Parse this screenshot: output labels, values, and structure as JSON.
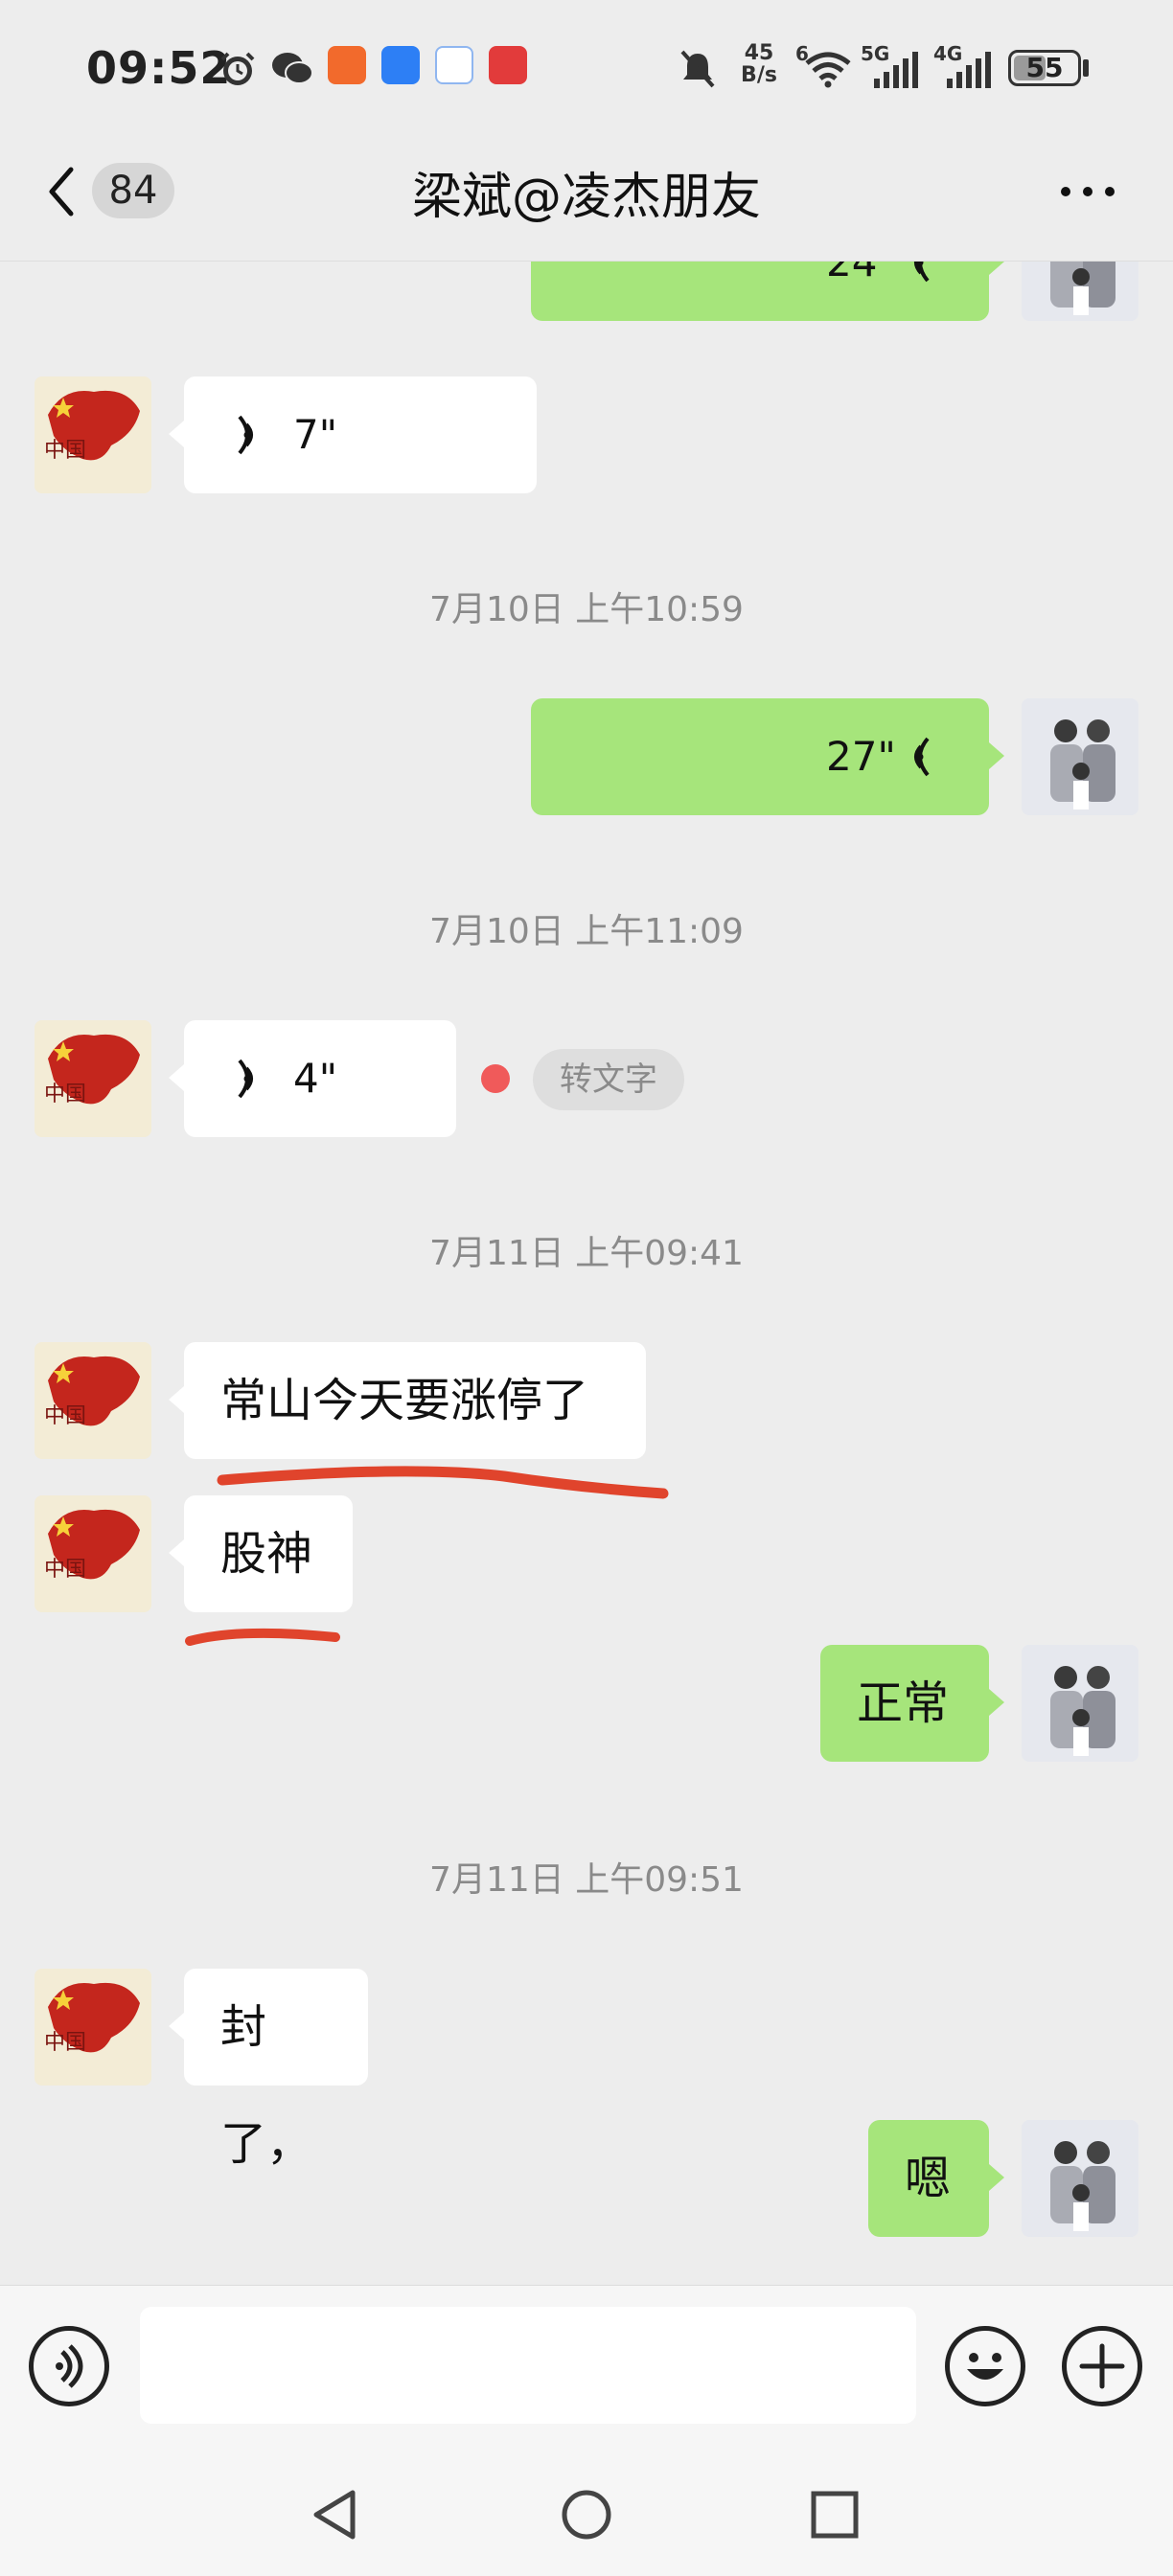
{
  "status_bar": {
    "time": "09:52",
    "net_speed_top": "45",
    "net_speed_bottom": "B/s",
    "wifi_label": "6",
    "sim1": "5G",
    "sim2": "4G",
    "battery": "55",
    "battery_level_percent": 55,
    "icons": [
      "alarm-icon",
      "wechat-icon",
      "app-orange-icon",
      "app-blue-icon",
      "app-chat-icon",
      "app-red-icon",
      "mute-icon",
      "wifi-icon",
      "signal-icon",
      "signal-icon-2",
      "battery-icon"
    ]
  },
  "header": {
    "unread_count": "84",
    "title": "梁斌@凌杰朋友",
    "back_icon": "chevron-left-icon",
    "more_icon": "more-dots-icon"
  },
  "messages": [
    {
      "side": "right",
      "type": "voice",
      "duration": "24\""
    },
    {
      "side": "left",
      "type": "voice",
      "duration": "7\""
    },
    {
      "type": "timestamp",
      "text": "7月10日 上午10:59"
    },
    {
      "side": "right",
      "type": "voice",
      "duration": "27\""
    },
    {
      "type": "timestamp",
      "text": "7月10日 上午11:09"
    },
    {
      "side": "left",
      "type": "voice",
      "duration": "4\"",
      "unread": true,
      "convert_label": "转文字"
    },
    {
      "type": "timestamp",
      "text": "7月11日 上午09:41"
    },
    {
      "side": "left",
      "type": "text",
      "text": "常山今天要涨停了"
    },
    {
      "side": "left",
      "type": "text",
      "text": "股神"
    },
    {
      "side": "right",
      "type": "text",
      "text": "正常"
    },
    {
      "type": "timestamp",
      "text": "7月11日 上午09:51"
    },
    {
      "side": "left",
      "type": "text",
      "text": "封了，"
    },
    {
      "side": "right",
      "type": "text",
      "text": "嗯"
    }
  ],
  "input_bar": {
    "voice_icon": "voice-input-icon",
    "text_value": "",
    "emoji_icon": "emoji-icon",
    "plus_icon": "plus-icon"
  },
  "system_nav": {
    "icons": [
      "back-triangle-icon",
      "home-circle-icon",
      "recents-square-icon"
    ]
  },
  "colors": {
    "background": "#ededed",
    "bubble_green": "#a6e57b",
    "bubble_white": "#ffffff",
    "annotation_red": "#e0442c",
    "unread_dot": "#f05a5a"
  }
}
